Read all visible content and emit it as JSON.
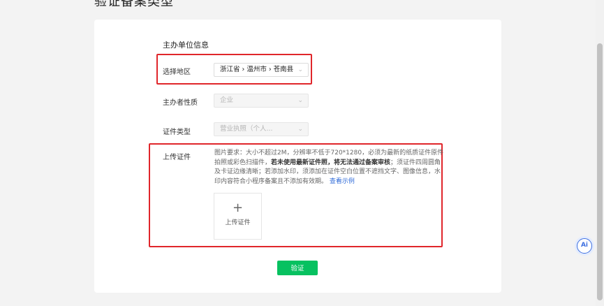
{
  "page": {
    "title": "验证备案类型"
  },
  "form": {
    "section_title": "主办单位信息",
    "region": {
      "label": "选择地区",
      "value": "浙江省 › 温州市 › 苍南县"
    },
    "nature": {
      "label": "主办者性质",
      "value": "企业"
    },
    "cert_type": {
      "label": "证件类型",
      "value": "营业执照（个人..."
    },
    "upload": {
      "label": "上传证件",
      "hint_part1": "图片要求：大小不超过2M，分辨率不低于720*1280，必须为最新的纸质证件原件拍照或彩色扫描件，",
      "hint_bold": "若未使用最新证件照，将无法通过备案审核",
      "hint_part2": "；须证件四周圆角及卡证边缘清晰；若添加水印，须添加在证件空白位置不遮挡文字、图像信息，水印内容符合小程序备案且不添加有效期。",
      "hint_link": "查看示例",
      "box_plus": "+",
      "box_label": "上传证件"
    },
    "verify_label": "验证"
  },
  "ai_label": "Ai",
  "colors": {
    "highlight": "#e0262b",
    "primary": "#07c160",
    "link": "#2f6bd8"
  }
}
